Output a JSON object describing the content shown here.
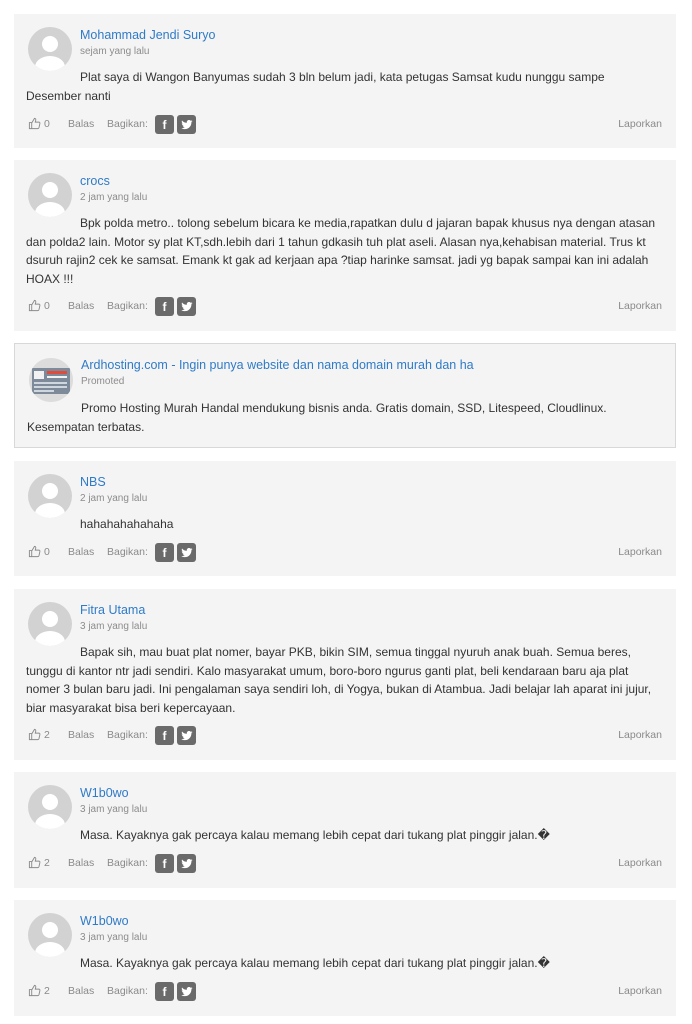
{
  "labels": {
    "reply": "Balas",
    "share": "Bagikan:",
    "report": "Laporkan",
    "facebook_glyph": "f"
  },
  "comments": [
    {
      "name": "Mohammad Jendi Suryo",
      "time": "sejam yang lalu",
      "text": "Plat saya di Wangon Banyumas sudah 3 bln belum jadi, kata petugas Samsat kudu nunggu sampe Desember nanti",
      "likes": "0"
    },
    {
      "name": "crocs",
      "time": "2 jam yang lalu",
      "text": "Bpk polda metro.. tolong sebelum bicara ke media,rapatkan dulu d jajaran bapak khusus nya dengan atasan dan polda2 lain. Motor sy plat KT,sdh.lebih dari 1 tahun gdkasih tuh plat aseli. Alasan nya,kehabisan material. Trus kt dsuruh rajin2 cek ke samsat. Emank kt gak ad kerjaan apa ?tiap harinke samsat. jadi yg bapak sampai kan ini adalah HOAX !!!",
      "likes": "0"
    },
    {
      "name": "NBS",
      "time": "2 jam yang lalu",
      "text": "hahahahahahaha",
      "likes": "0"
    },
    {
      "name": "Fitra Utama",
      "time": "3 jam yang lalu",
      "text": "Bapak sih, mau buat plat nomer, bayar PKB, bikin SIM, semua tinggal nyuruh anak buah. Semua beres, tunggu di kantor ntr jadi sendiri. Kalo masyarakat umum, boro-boro ngurus ganti plat, beli kendaraan baru aja plat nomer 3 bulan baru jadi. Ini pengalaman saya sendiri loh, di Yogya, bukan di Atambua. Jadi belajar lah aparat ini jujur, biar masyarakat bisa beri kepercayaan.",
      "likes": "2"
    },
    {
      "name": "W1b0wo",
      "time": "3 jam yang lalu",
      "text": "Masa. Kayaknya gak percaya kalau memang lebih cepat dari tukang plat pinggir jalan.�",
      "likes": "2"
    },
    {
      "name": "W1b0wo",
      "time": "3 jam yang lalu",
      "text": "Masa. Kayaknya gak percaya kalau memang lebih cepat dari tukang plat pinggir jalan.�",
      "likes": "2"
    }
  ],
  "promo": {
    "title": "Ardhosting.com - Ingin punya website dan nama domain murah dan ha",
    "label": "Promoted",
    "text": "Promo Hosting Murah Handal mendukung bisnis anda. Gratis domain, SSD, Litespeed, Cloudlinux. Kesempatan terbatas."
  }
}
